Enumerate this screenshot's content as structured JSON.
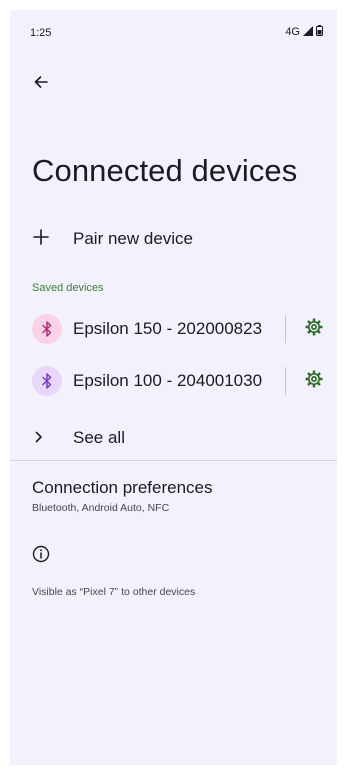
{
  "status_bar": {
    "time": "1:25",
    "network": "4G",
    "icons": [
      "signal-icon",
      "battery-icon"
    ]
  },
  "header": {
    "back_icon": "arrow-left-icon",
    "title": "Connected devices"
  },
  "pair": {
    "icon": "plus-icon",
    "label": "Pair new device"
  },
  "saved_devices": {
    "header": "Saved devices",
    "items": [
      {
        "name": "Epsilon 150 - 202000823",
        "icon": "bluetooth-icon",
        "icon_bg": "#f9d2e6",
        "icon_color": "#b0307a",
        "settings_icon": "gear-icon"
      },
      {
        "name": "Epsilon 100 - 204001030",
        "icon": "bluetooth-icon",
        "icon_bg": "#e8d7f8",
        "icon_color": "#7a3fb8",
        "settings_icon": "gear-icon"
      }
    ]
  },
  "see_all": {
    "icon": "chevron-right-icon",
    "label": "See all"
  },
  "connection_preferences": {
    "title": "Connection preferences",
    "subtitle": "Bluetooth, Android Auto, NFC"
  },
  "info": {
    "icon": "info-icon",
    "text": "Visible as “Pixel 7” to other devices"
  },
  "colors": {
    "background": "#f3f1fb",
    "accent_green": "#3e7d3a",
    "text_primary": "#1c1b1f",
    "text_secondary": "#49454f"
  }
}
